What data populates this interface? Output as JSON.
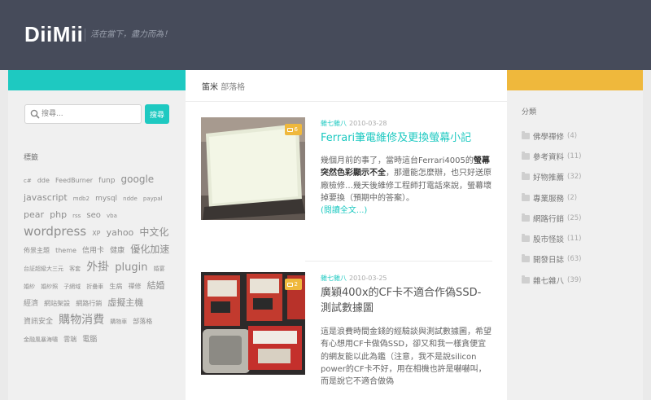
{
  "header": {
    "site_title": "DiiMii",
    "tagline": "活在當下，盡力而為！"
  },
  "page": {
    "heading_main": "笛米",
    "heading_sub": "部落格"
  },
  "search": {
    "placeholder": "搜尋...",
    "button_label": "搜尋"
  },
  "tags": {
    "title": "標籤",
    "items": [
      {
        "text": "c#",
        "size": 7
      },
      {
        "text": "dde",
        "size": 8
      },
      {
        "text": "FeedBurner",
        "size": 8
      },
      {
        "text": "funp",
        "size": 9
      },
      {
        "text": "google",
        "size": 12
      },
      {
        "text": "javascript",
        "size": 11
      },
      {
        "text": "mdb2",
        "size": 7
      },
      {
        "text": "mysql",
        "size": 9
      },
      {
        "text": "ndde",
        "size": 7
      },
      {
        "text": "paypal",
        "size": 7
      },
      {
        "text": "pear",
        "size": 11
      },
      {
        "text": "php",
        "size": 11
      },
      {
        "text": "rss",
        "size": 7
      },
      {
        "text": "seo",
        "size": 10
      },
      {
        "text": "vba",
        "size": 7
      },
      {
        "text": "wordpress",
        "size": 15
      },
      {
        "text": "XP",
        "size": 8
      },
      {
        "text": "yahoo",
        "size": 11
      },
      {
        "text": "中文化",
        "size": 12
      },
      {
        "text": "佈景主題",
        "size": 8
      },
      {
        "text": "theme",
        "size": 8
      },
      {
        "text": "信用卡",
        "size": 9
      },
      {
        "text": "健康",
        "size": 9
      },
      {
        "text": "優化加速",
        "size": 12
      },
      {
        "text": "台証超級大三元",
        "size": 7
      },
      {
        "text": "客套",
        "size": 7
      },
      {
        "text": "外掛",
        "size": 14
      },
      {
        "text": "plugin",
        "size": 13
      },
      {
        "text": "婚宴",
        "size": 7
      },
      {
        "text": "婚紗",
        "size": 7
      },
      {
        "text": "婚紗照",
        "size": 7
      },
      {
        "text": "子網域",
        "size": 7
      },
      {
        "text": "折疊車",
        "size": 7
      },
      {
        "text": "生病",
        "size": 8
      },
      {
        "text": "禪修",
        "size": 8
      },
      {
        "text": "結婚",
        "size": 11
      },
      {
        "text": "經濟",
        "size": 9
      },
      {
        "text": "網站架設",
        "size": 8
      },
      {
        "text": "網路行銷",
        "size": 8
      },
      {
        "text": "虛擬主機",
        "size": 11
      },
      {
        "text": "資訊安全",
        "size": 9
      },
      {
        "text": "購物消費",
        "size": 14
      },
      {
        "text": "購物車",
        "size": 7
      },
      {
        "text": "部落格",
        "size": 8
      },
      {
        "text": "金融風暴海嘯",
        "size": 7
      },
      {
        "text": "雲端",
        "size": 8
      },
      {
        "text": "電腦",
        "size": 9
      }
    ]
  },
  "categories": {
    "title": "分類",
    "items": [
      {
        "label": "佛學禪修",
        "count": "(4)"
      },
      {
        "label": "參考資料",
        "count": "(11)"
      },
      {
        "label": "好物推薦",
        "count": "(32)"
      },
      {
        "label": "專業服務",
        "count": "(2)"
      },
      {
        "label": "網路行銷",
        "count": "(25)"
      },
      {
        "label": "股市怪談",
        "count": "(11)"
      },
      {
        "label": "開發日誌",
        "count": "(63)"
      },
      {
        "label": "雜七雜八",
        "count": "(39)"
      }
    ]
  },
  "posts": [
    {
      "category": "雜七雜八",
      "date": "2010-03-28",
      "title": "Ferrari筆電維修及更換螢幕小記",
      "comments": "6",
      "excerpt_pre": "幾個月前的事了，當時這台Ferrari4005的",
      "excerpt_bold": "螢幕突然色彩顯示不全",
      "excerpt_post": "，那還能怎麼辦，也只好送原廠檢修…幾天後維修工程師打電話來說，螢幕壞掉要換（預期中的答案）。",
      "read_more": "(閱讀全文...)"
    },
    {
      "category": "雜七雜八",
      "date": "2010-03-25",
      "title": "廣穎400x的CF卡不適合作偽SSD-測試數據圖",
      "comments": "2",
      "excerpt": "這是浪費時間金錢的經驗談與測試數據圖，希望有心想用CF卡做偽SSD，卻又和我一樣貪便宜的網友能以此為鑑（注意，我不是說silicon power的CF卡不好，用在相機也許是嚇嚇叫，而是說它不適合做偽"
    }
  ],
  "colors": {
    "header_bg": "#464b5a",
    "accent_teal": "#1ec9c1",
    "accent_yellow": "#efb83c",
    "sidebar_bg": "#f0f0f0"
  }
}
